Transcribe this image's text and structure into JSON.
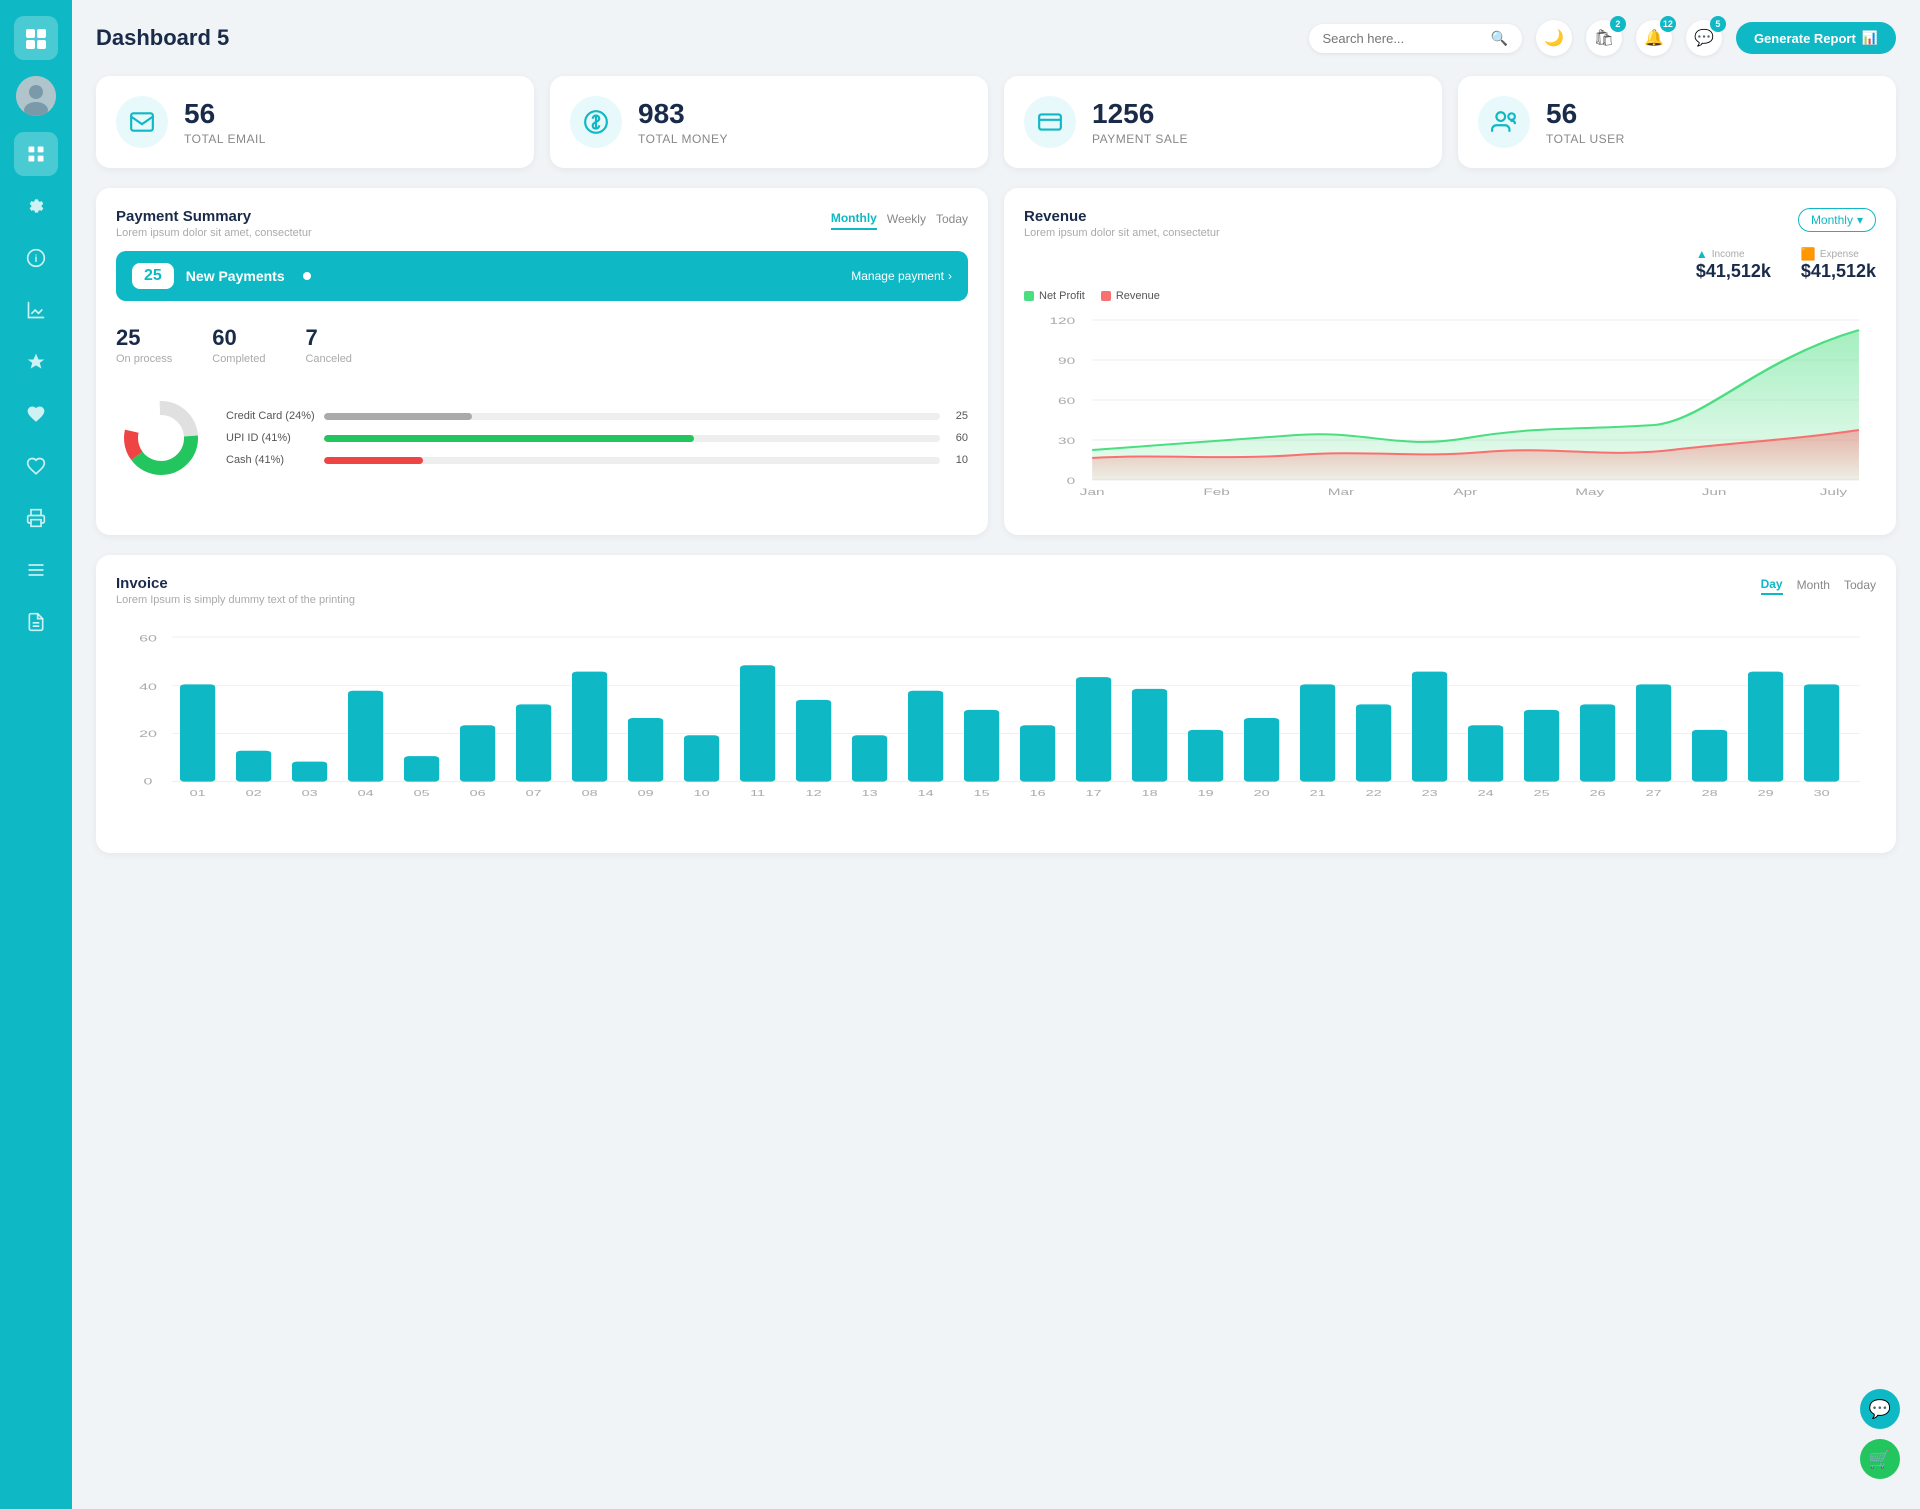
{
  "sidebar": {
    "logo_icon": "📋",
    "items": [
      {
        "id": "dashboard",
        "icon": "▦",
        "active": true
      },
      {
        "id": "settings",
        "icon": "⚙"
      },
      {
        "id": "info",
        "icon": "ℹ"
      },
      {
        "id": "chart",
        "icon": "📊"
      },
      {
        "id": "star",
        "icon": "★"
      },
      {
        "id": "heart",
        "icon": "♥"
      },
      {
        "id": "heart2",
        "icon": "♥"
      },
      {
        "id": "print",
        "icon": "🖨"
      },
      {
        "id": "list",
        "icon": "☰"
      },
      {
        "id": "doc",
        "icon": "📄"
      }
    ]
  },
  "header": {
    "title": "Dashboard 5",
    "search_placeholder": "Search here...",
    "generate_btn": "Generate Report",
    "icon_badges": [
      {
        "id": "bag",
        "icon": "🛍",
        "count": "2"
      },
      {
        "id": "bell",
        "icon": "🔔",
        "count": "12"
      },
      {
        "id": "chat",
        "icon": "💬",
        "count": "5"
      }
    ]
  },
  "stats": [
    {
      "id": "email",
      "icon": "📋",
      "number": "56",
      "label": "TOTAL EMAIL"
    },
    {
      "id": "money",
      "icon": "$",
      "number": "983",
      "label": "TOTAL MONEY"
    },
    {
      "id": "payment",
      "icon": "💳",
      "number": "1256",
      "label": "PAYMENT SALE"
    },
    {
      "id": "user",
      "icon": "👥",
      "number": "56",
      "label": "TOTAL USER"
    }
  ],
  "payment_summary": {
    "title": "Payment Summary",
    "subtitle": "Lorem ipsum dolor sit amet, consectetur",
    "tabs": [
      "Monthly",
      "Weekly",
      "Today"
    ],
    "active_tab": "Monthly",
    "new_payments_count": "25",
    "new_payments_label": "New Payments",
    "manage_link": "Manage payment",
    "on_process": {
      "num": "25",
      "label": "On process"
    },
    "completed": {
      "num": "60",
      "label": "Completed"
    },
    "canceled": {
      "num": "7",
      "label": "Canceled"
    },
    "breakdown": [
      {
        "label": "Credit Card (24%)",
        "pct": 24,
        "color": "#aaa",
        "val": "25"
      },
      {
        "label": "UPI ID (41%)",
        "pct": 60,
        "color": "#22c55e",
        "val": "60"
      },
      {
        "label": "Cash (41%)",
        "pct": 16,
        "color": "#ef4444",
        "val": "10"
      }
    ]
  },
  "revenue": {
    "title": "Revenue",
    "subtitle": "Lorem ipsum dolor sit amet, consectetur",
    "monthly_label": "Monthly",
    "income_label": "Income",
    "income_val": "$41,512k",
    "expense_label": "Expense",
    "expense_val": "$41,512k",
    "legend": [
      {
        "label": "Net Profit",
        "color": "#4ade80"
      },
      {
        "label": "Revenue",
        "color": "#f87171"
      }
    ],
    "x_labels": [
      "Jan",
      "Feb",
      "Mar",
      "Apr",
      "May",
      "Jun",
      "July"
    ]
  },
  "invoice": {
    "title": "Invoice",
    "subtitle": "Lorem Ipsum is simply dummy text of the printing",
    "tabs": [
      "Day",
      "Month",
      "Today"
    ],
    "active_tab": "Day",
    "y_labels": [
      "0",
      "20",
      "40",
      "60"
    ],
    "x_labels": [
      "01",
      "02",
      "03",
      "04",
      "05",
      "06",
      "07",
      "08",
      "09",
      "10",
      "11",
      "12",
      "13",
      "14",
      "15",
      "16",
      "17",
      "18",
      "19",
      "20",
      "21",
      "22",
      "23",
      "24",
      "25",
      "26",
      "27",
      "28",
      "29",
      "30"
    ],
    "bar_data": [
      38,
      12,
      8,
      35,
      10,
      22,
      30,
      43,
      25,
      18,
      45,
      32,
      18,
      35,
      28,
      22,
      40,
      36,
      20,
      25,
      38,
      30,
      43,
      22,
      28,
      30,
      38,
      20,
      43,
      38
    ]
  },
  "float_buttons": [
    {
      "id": "support",
      "icon": "💬",
      "color": "teal"
    },
    {
      "id": "cart",
      "icon": "🛒",
      "color": "green"
    }
  ]
}
